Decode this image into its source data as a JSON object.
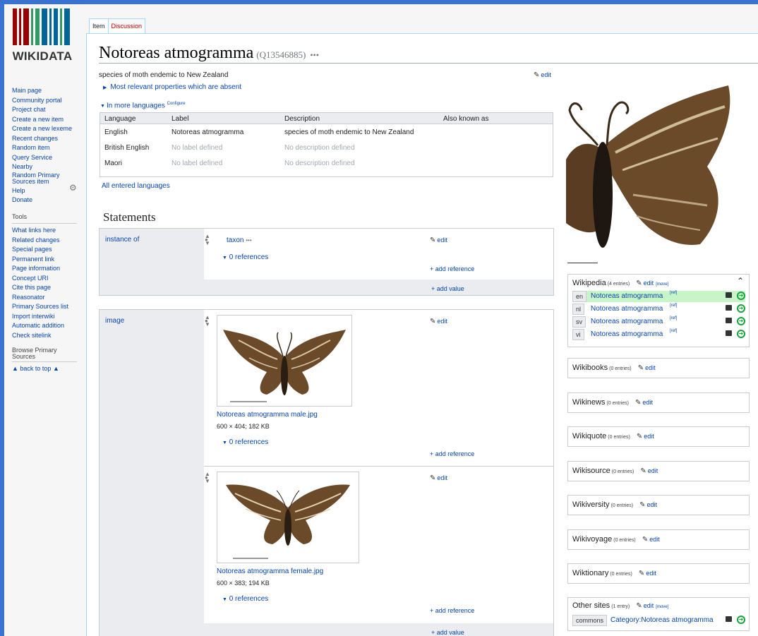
{
  "logo": {
    "text": "WIKIDATA",
    "bar_colors": [
      "#990000",
      "#990000",
      "#339966",
      "#339966",
      "#006699",
      "#006699",
      "#990000",
      "#339966",
      "#006699"
    ]
  },
  "nav": {
    "items": [
      "Main page",
      "Community portal",
      "Project chat",
      "Create a new item",
      "Create a new lexeme",
      "Recent changes",
      "Random item",
      "Query Service",
      "Nearby",
      "Random Primary Sources item",
      "Help",
      "Donate"
    ],
    "tools_heading": "Tools",
    "tools": [
      "What links here",
      "Related changes",
      "Special pages",
      "Permanent link",
      "Page information",
      "Concept URI",
      "Cite this page",
      "Reasonator",
      "Primary Sources list",
      "Import interwiki",
      "Automatic addition",
      "Check sitelink"
    ],
    "browse": "Browse Primary Sources",
    "back_to_top": "▲ back to top ▲"
  },
  "tabs": {
    "item": "Item",
    "discussion": "Discussion"
  },
  "page": {
    "title": "Notoreas atmogramma",
    "qid": "(Q13546885)",
    "more": "•••",
    "description": "species of moth endemic to New Zealand",
    "edit": "edit",
    "absent": "Most relevant properties which are absent",
    "in_more_languages": "In more languages",
    "configure": "Configure",
    "all_languages": "All entered languages"
  },
  "lang_table": {
    "headers": [
      "Language",
      "Label",
      "Description",
      "Also known as"
    ],
    "rows": [
      {
        "language": "English",
        "label": "Notoreas atmogramma",
        "description": "species of moth endemic to New Zealand"
      },
      {
        "language": "British English",
        "label": "No label defined",
        "description": "No description defined"
      },
      {
        "language": "Maori",
        "label": "No label defined",
        "description": "No description defined"
      }
    ]
  },
  "statements": {
    "heading": "Statements",
    "instance_of": {
      "property": "instance of",
      "value": "taxon",
      "refs": "0 references",
      "add_reference": "+ add reference",
      "add_value": "+ add value"
    },
    "image": {
      "property": "image",
      "files": [
        {
          "name": "Notoreas atmogramma male.jpg",
          "info": "600 × 404; 182 KB"
        },
        {
          "name": "Notoreas atmogramma female.jpg",
          "info": "600 × 383; 194 KB"
        }
      ],
      "refs": "0 references",
      "add_reference": "+ add reference",
      "add_value": "+ add value"
    }
  },
  "sitelinks": {
    "wikipedia": {
      "title": "Wikipedia",
      "count": "(4 entries)",
      "move": "[move]",
      "rows": [
        {
          "code": "en",
          "title": "Notoreas atmogramma",
          "ref": "[ref]"
        },
        {
          "code": "nl",
          "title": "Notoreas atmogramma",
          "ref": "[ref]"
        },
        {
          "code": "sv",
          "title": "Notoreas atmogramma",
          "ref": "[ref]"
        },
        {
          "code": "vi",
          "title": "Notoreas atmogramma",
          "ref": "[ref]"
        }
      ]
    },
    "groups": [
      {
        "title": "Wikibooks",
        "count": "(0 entries)"
      },
      {
        "title": "Wikinews",
        "count": "(0 entries)"
      },
      {
        "title": "Wikiquote",
        "count": "(0 entries)"
      },
      {
        "title": "Wikisource",
        "count": "(0 entries)"
      },
      {
        "title": "Wikiversity",
        "count": "(0 entries)"
      },
      {
        "title": "Wikivoyage",
        "count": "(0 entries)"
      },
      {
        "title": "Wiktionary",
        "count": "(0 entries)"
      }
    ],
    "other": {
      "title": "Other sites",
      "count": "(1 entry)",
      "move": "[move]",
      "code": "commons",
      "link": "Category:Notoreas atmogramma"
    }
  },
  "colors": {
    "link": "#0645ad",
    "highlight": "#c8f5c8",
    "accent_go": "#14a53c"
  }
}
